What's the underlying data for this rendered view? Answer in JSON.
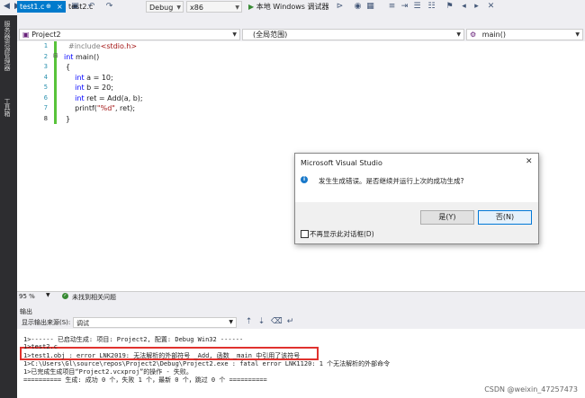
{
  "toolbar": {
    "config": "Debug",
    "platform": "x86",
    "debugger": "本地 Windows 调试器"
  },
  "left_strip": {
    "items": [
      "服务器资源管理器",
      "工具箱"
    ]
  },
  "tabs": [
    {
      "label": "test1.c",
      "close": "×",
      "pin": "⊕"
    },
    {
      "label": "test2.c"
    }
  ],
  "nav": {
    "project": "Project2",
    "scope": "(全局范围)",
    "func": "main()"
  },
  "code": {
    "line_numbers": [
      "1",
      "2",
      "3",
      "4",
      "5",
      "6",
      "7",
      "8"
    ],
    "lines": [
      {
        "parts": [
          {
            "t": "#include",
            "c": "pp"
          },
          {
            "t": "<stdio.h>",
            "c": "str"
          }
        ]
      },
      {
        "parts": [
          {
            "t": "int",
            "c": "kw"
          },
          {
            "t": " main()",
            "c": ""
          }
        ]
      },
      {
        "parts": [
          {
            "t": "{",
            "c": ""
          }
        ]
      },
      {
        "parts": [
          {
            "t": "    ",
            "c": ""
          },
          {
            "t": "int",
            "c": "kw"
          },
          {
            "t": " a = 10;",
            "c": ""
          }
        ]
      },
      {
        "parts": [
          {
            "t": "    ",
            "c": ""
          },
          {
            "t": "int",
            "c": "kw"
          },
          {
            "t": " b = 20;",
            "c": ""
          }
        ]
      },
      {
        "parts": [
          {
            "t": "    ",
            "c": ""
          },
          {
            "t": "int",
            "c": "kw"
          },
          {
            "t": " ret = Add(a, b);",
            "c": ""
          }
        ]
      },
      {
        "parts": [
          {
            "t": "    printf(",
            "c": ""
          },
          {
            "t": "\"%d\"",
            "c": "str"
          },
          {
            "t": ", ret);",
            "c": ""
          }
        ]
      },
      {
        "parts": [
          {
            "t": "}",
            "c": ""
          }
        ]
      }
    ]
  },
  "edit_status": {
    "zoom": "95 %",
    "issues": "未找到相关问题"
  },
  "output": {
    "title": "输出",
    "source_label": "显示输出来源(S):",
    "source_value": "调试",
    "lines": [
      "1>------ 已启动生成: 项目: Project2, 配置: Debug Win32 ------",
      "1>test2.c",
      "1>test1.obj : error LNK2019: 无法解析的外部符号 _Add, 函数 _main 中引用了该符号",
      "1>C:\\Users\\Gl\\source\\repos\\Project2\\Debug\\Project2.exe : fatal error LNK1120: 1 个无法解析的外部命令",
      "1>已完成生成项目“Project2.vcxproj”的操作 - 失败。",
      "========== 生成: 成功 0 个，失败 1 个，最新 0 个，跳过 0 个 =========="
    ]
  },
  "dialog": {
    "title": "Microsoft Visual Studio",
    "message": "发生生成错误。是否继续并运行上次的成功生成?",
    "yes": "是(Y)",
    "no": "否(N)",
    "checkbox": "不再显示此对话框(D)"
  },
  "watermark": "CSDN @weixin_47257473",
  "colors": {
    "accent": "#007acc",
    "error_box": "#e0322e"
  }
}
